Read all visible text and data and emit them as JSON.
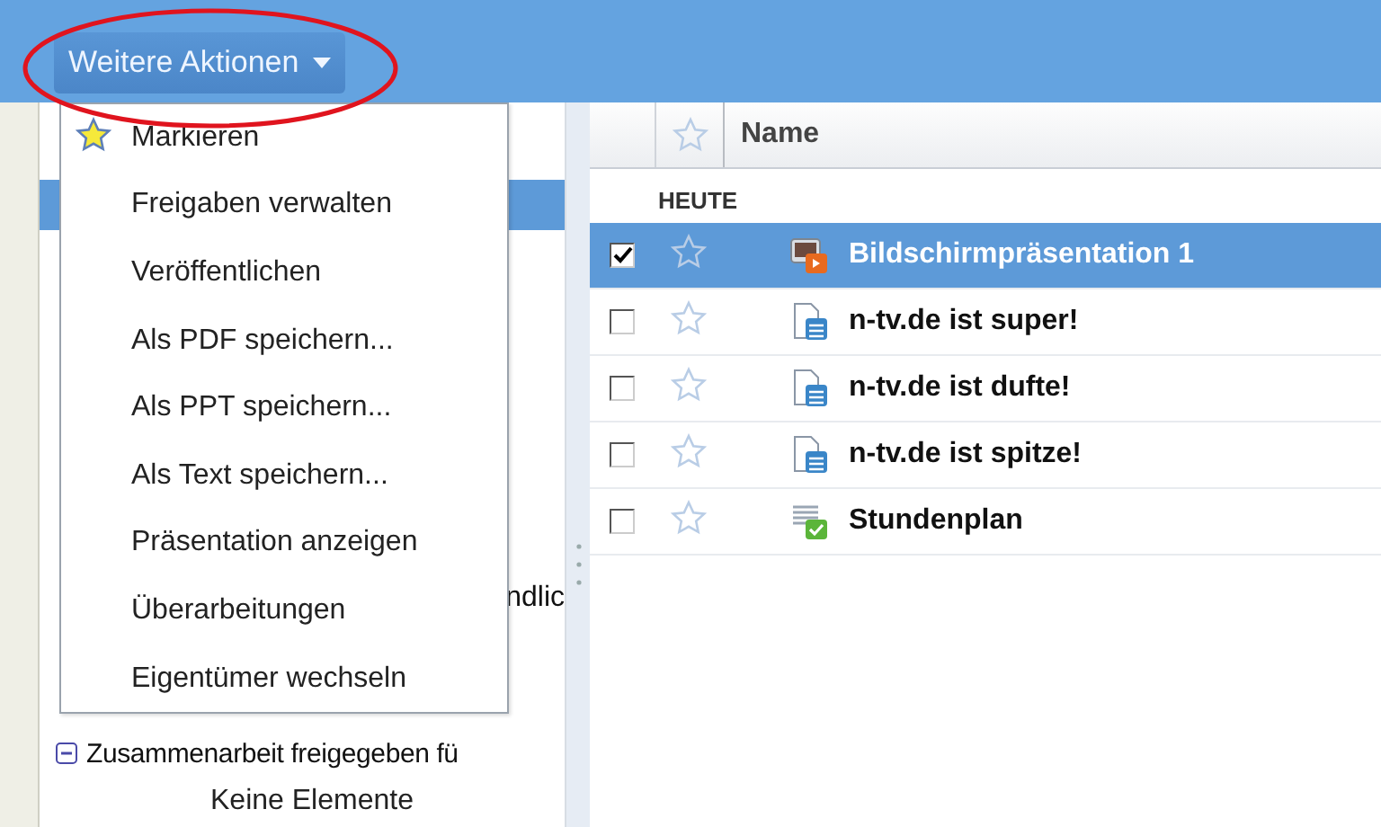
{
  "toolbar": {
    "more_actions_button": {
      "label": "Weitere Aktionen"
    }
  },
  "menu": {
    "items": [
      {
        "label": "Markieren",
        "kind": "star"
      },
      {
        "label": "Freigaben verwalten",
        "kind": "plain"
      },
      {
        "label": "Veröffentlichen",
        "kind": "plain"
      },
      {
        "label": "Als PDF speichern...",
        "kind": "plain"
      },
      {
        "label": "Als PPT speichern...",
        "kind": "plain"
      },
      {
        "label": "Als Text speichern...",
        "kind": "plain"
      },
      {
        "label": "Präsentation anzeigen",
        "kind": "plain"
      },
      {
        "label": "Überarbeitungen",
        "kind": "plain"
      },
      {
        "label": "Eigentümer wechseln",
        "kind": "plain"
      }
    ]
  },
  "sidebar": {
    "items": [
      {
        "selected": true
      },
      {
        "label": "ndlic",
        "selected": false
      }
    ],
    "section": {
      "label": "Zusammenarbeit freigegeben fü",
      "expanded": true,
      "empty_text": "Keine Elemente"
    }
  },
  "file_list": {
    "columns": [
      "Name"
    ],
    "group": "HEUTE",
    "rows": [
      {
        "name": "Bildschirmpräsentation 1",
        "kind": "presentation",
        "checked": true,
        "selected": true
      },
      {
        "name": "n-tv.de ist super!",
        "kind": "document",
        "checked": false,
        "selected": false
      },
      {
        "name": "n-tv.de ist dufte!",
        "kind": "document",
        "checked": false,
        "selected": false
      },
      {
        "name": "n-tv.de ist spitze!",
        "kind": "document",
        "checked": false,
        "selected": false
      },
      {
        "name": "Stundenplan",
        "kind": "spreadsheet",
        "checked": false,
        "selected": false
      }
    ]
  }
}
